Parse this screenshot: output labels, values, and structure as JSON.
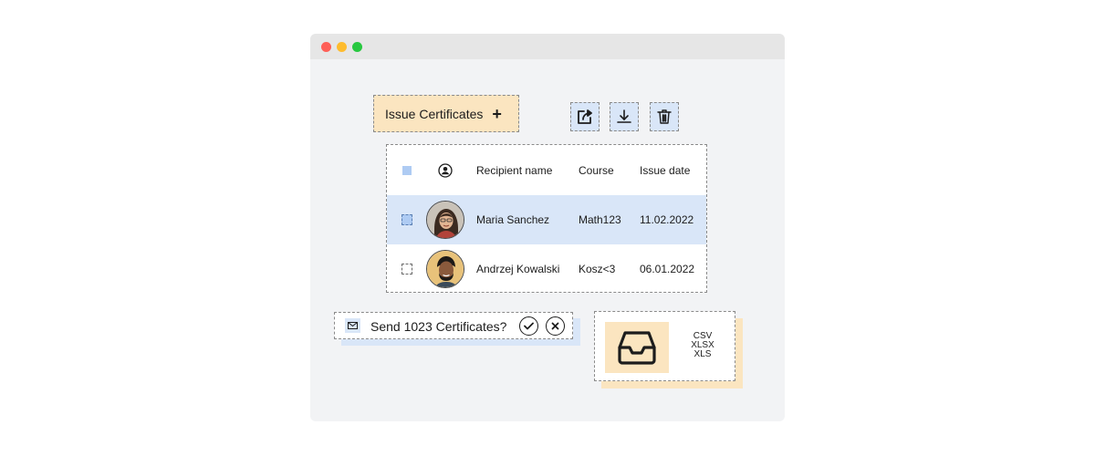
{
  "toolbar": {
    "issue_label": "Issue Certificates",
    "issue_icon": "+",
    "actions": [
      "share-icon",
      "download-icon",
      "trash-icon"
    ]
  },
  "table": {
    "columns": [
      "Recipient name",
      "Course",
      "Issue date"
    ],
    "header_icon": "user-icon",
    "rows": [
      {
        "name": "Maria Sanchez",
        "course": "Math123",
        "date": "11.02.2022",
        "selected": true
      },
      {
        "name": "Andrzej Kowalski",
        "course": "Kosz<3",
        "date": "06.01.2022",
        "selected": false
      }
    ]
  },
  "send": {
    "icon": "mail-icon",
    "label": "Send 1023 Certificates?"
  },
  "export": {
    "icon": "inbox-icon",
    "formats": [
      "CSV",
      "XLSX",
      "XLS"
    ]
  },
  "colors": {
    "accent_blue": "#d9e6f8",
    "accent_orange": "#fbe5c0",
    "window_bg": "#f2f3f5"
  }
}
